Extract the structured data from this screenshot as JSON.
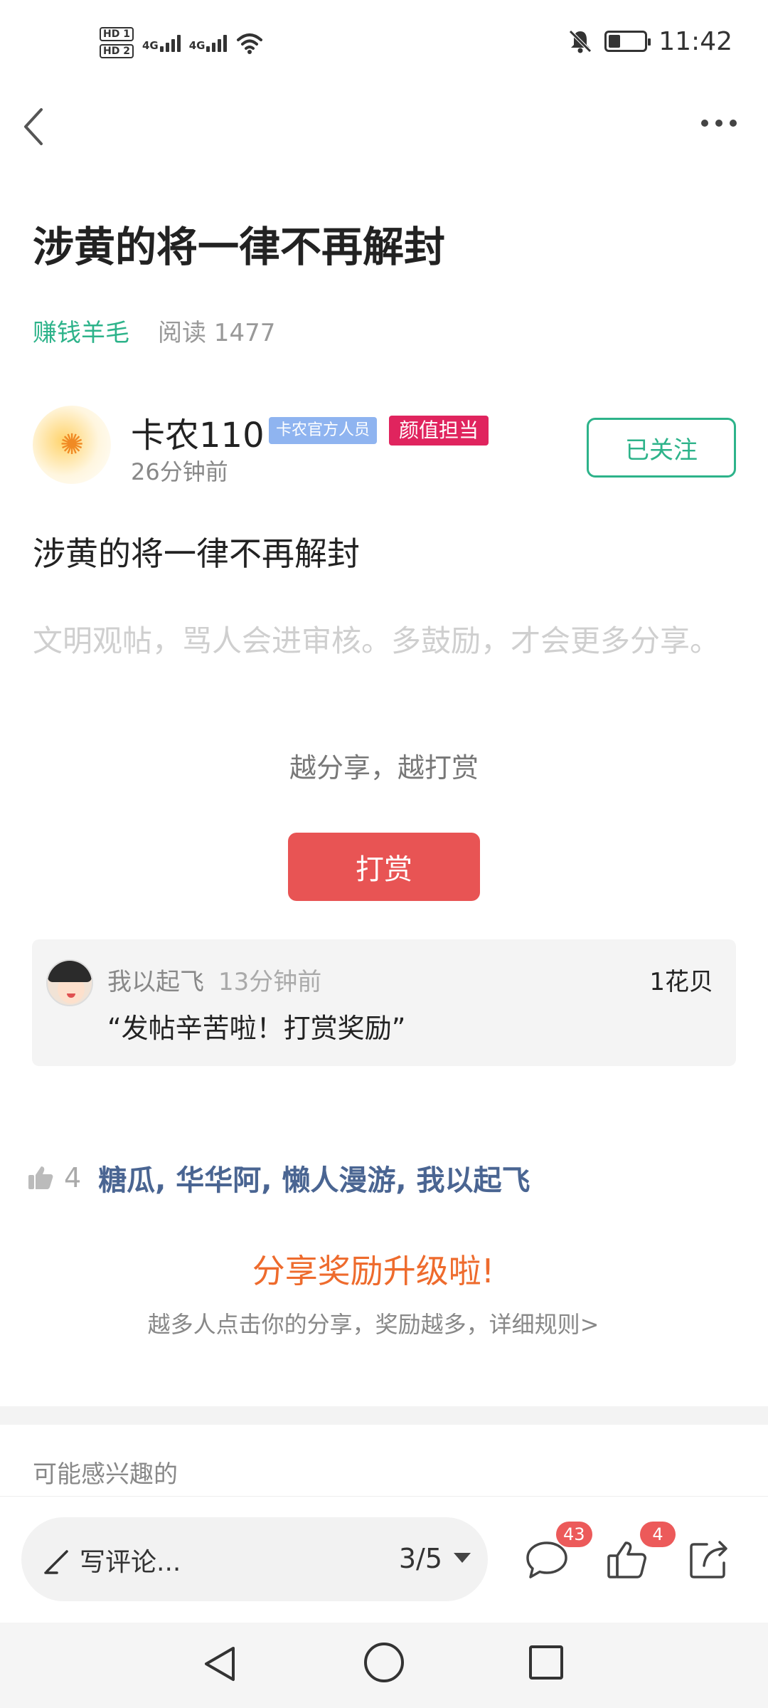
{
  "status_bar": {
    "sim1": "HD 1",
    "sim2": "HD 2",
    "net1": "4G",
    "net2": "4G",
    "time": "11:42"
  },
  "post": {
    "title": "涉黄的将一律不再解封",
    "category": "赚钱羊毛",
    "reads_label": "阅读 1477",
    "author": {
      "name": "卡农110",
      "badge_official": "卡农官方人员",
      "badge_title": "颜值担当",
      "time": "26分钟前",
      "follow_label": "已关注"
    },
    "body": "涉黄的将一律不再解封",
    "hint": "文明观帖，骂人会进审核。多鼓励，才会更多分享。",
    "share_reward": "越分享，越打赏",
    "tip_button": "打赏"
  },
  "tip_record": {
    "user": "我以起飞",
    "ago": "13分钟前",
    "amount": "1花贝",
    "message": "“发帖辛苦啦！打赏奖励”"
  },
  "likes": {
    "count": "4",
    "names": "糖瓜, 华华阿, 懒人漫游, 我以起飞"
  },
  "upgrade": {
    "title": "分享奖励升级啦!",
    "subtitle": "越多人点击你的分享，奖励越多，详细规则>"
  },
  "interest_label": "可能感兴趣的",
  "bottom_bar": {
    "comment_placeholder": "写评论...",
    "page_indicator": "3/5",
    "comment_count": "43",
    "like_count": "4"
  },
  "colors": {
    "accent_green": "#2db38a",
    "tip_red": "#e85454",
    "badge_pink": "#e0245e",
    "badge_blue": "#8fb4f0",
    "upgrade_orange": "#ee6b2d",
    "like_names_blue": "#4a6592"
  },
  "icons": [
    "back-arrow-icon",
    "more-dots-icon",
    "mute-bell-icon",
    "battery-icon",
    "wifi-icon",
    "signal-icon",
    "thumb-up-icon",
    "pencil-icon",
    "caret-down-icon",
    "comment-icon",
    "like-icon",
    "share-icon",
    "nav-back-icon",
    "nav-home-icon",
    "nav-recent-icon"
  ]
}
